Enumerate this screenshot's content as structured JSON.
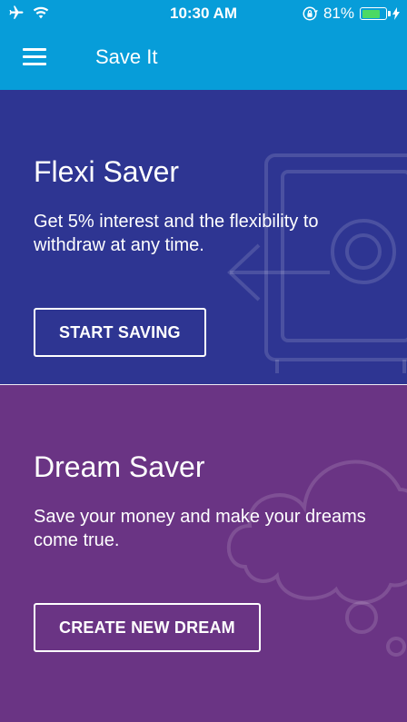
{
  "status_bar": {
    "time": "10:30 AM",
    "battery_percent": "81%",
    "battery_level": 0.81,
    "icons": [
      "airplane-icon",
      "wifi-icon",
      "orientation-lock-icon",
      "battery-icon",
      "charging-icon"
    ]
  },
  "app_bar": {
    "title": "Save It",
    "menu_icon": "hamburger-menu-icon",
    "color": "#079dd9"
  },
  "cards": [
    {
      "title": "Flexi Saver",
      "description": "Get 5% interest and the flexibility to withdraw at any time.",
      "button_label": "START SAVING",
      "background": "#2e3592",
      "illustration_icon": "safe-withdraw-icon"
    },
    {
      "title": "Dream Saver",
      "description": "Save your money and make your dreams come true.",
      "button_label": "CREATE NEW DREAM",
      "background": "#6a3484",
      "illustration_icon": "dream-cloud-icon"
    }
  ]
}
